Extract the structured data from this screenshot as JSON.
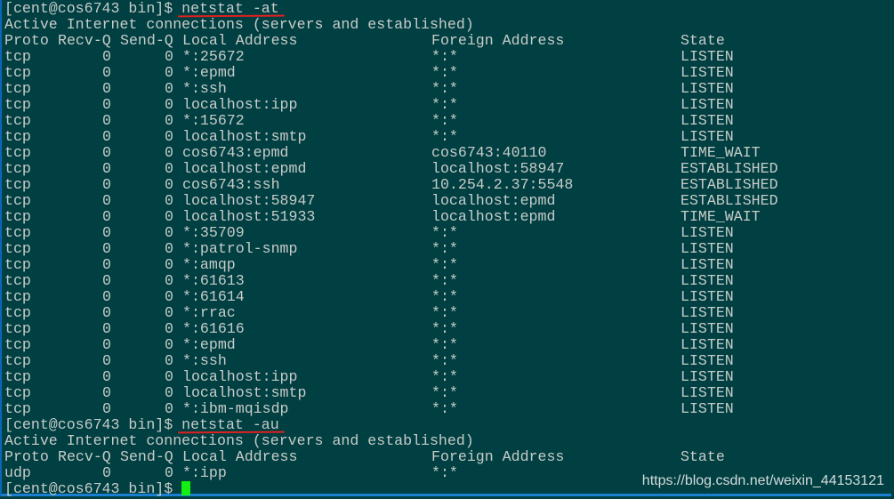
{
  "prompt": "[cent@cos6743 bin]$ ",
  "blocks": [
    {
      "command": "netstat -at",
      "title": "Active Internet connections (servers and established)",
      "headers": {
        "proto": "Proto",
        "recv": "Recv-Q",
        "send": "Send-Q",
        "local": "Local Address",
        "foreign": "Foreign Address",
        "state": "State"
      },
      "rows": [
        {
          "proto": "tcp",
          "recv": "0",
          "send": "0",
          "local": "*:25672",
          "foreign": "*:*",
          "state": "LISTEN"
        },
        {
          "proto": "tcp",
          "recv": "0",
          "send": "0",
          "local": "*:epmd",
          "foreign": "*:*",
          "state": "LISTEN"
        },
        {
          "proto": "tcp",
          "recv": "0",
          "send": "0",
          "local": "*:ssh",
          "foreign": "*:*",
          "state": "LISTEN"
        },
        {
          "proto": "tcp",
          "recv": "0",
          "send": "0",
          "local": "localhost:ipp",
          "foreign": "*:*",
          "state": "LISTEN"
        },
        {
          "proto": "tcp",
          "recv": "0",
          "send": "0",
          "local": "*:15672",
          "foreign": "*:*",
          "state": "LISTEN"
        },
        {
          "proto": "tcp",
          "recv": "0",
          "send": "0",
          "local": "localhost:smtp",
          "foreign": "*:*",
          "state": "LISTEN"
        },
        {
          "proto": "tcp",
          "recv": "0",
          "send": "0",
          "local": "cos6743:epmd",
          "foreign": "cos6743:40110",
          "state": "TIME_WAIT"
        },
        {
          "proto": "tcp",
          "recv": "0",
          "send": "0",
          "local": "localhost:epmd",
          "foreign": "localhost:58947",
          "state": "ESTABLISHED"
        },
        {
          "proto": "tcp",
          "recv": "0",
          "send": "0",
          "local": "cos6743:ssh",
          "foreign": "10.254.2.37:5548",
          "state": "ESTABLISHED"
        },
        {
          "proto": "tcp",
          "recv": "0",
          "send": "0",
          "local": "localhost:58947",
          "foreign": "localhost:epmd",
          "state": "ESTABLISHED"
        },
        {
          "proto": "tcp",
          "recv": "0",
          "send": "0",
          "local": "localhost:51933",
          "foreign": "localhost:epmd",
          "state": "TIME_WAIT"
        },
        {
          "proto": "tcp",
          "recv": "0",
          "send": "0",
          "local": "*:35709",
          "foreign": "*:*",
          "state": "LISTEN"
        },
        {
          "proto": "tcp",
          "recv": "0",
          "send": "0",
          "local": "*:patrol-snmp",
          "foreign": "*:*",
          "state": "LISTEN"
        },
        {
          "proto": "tcp",
          "recv": "0",
          "send": "0",
          "local": "*:amqp",
          "foreign": "*:*",
          "state": "LISTEN"
        },
        {
          "proto": "tcp",
          "recv": "0",
          "send": "0",
          "local": "*:61613",
          "foreign": "*:*",
          "state": "LISTEN"
        },
        {
          "proto": "tcp",
          "recv": "0",
          "send": "0",
          "local": "*:61614",
          "foreign": "*:*",
          "state": "LISTEN"
        },
        {
          "proto": "tcp",
          "recv": "0",
          "send": "0",
          "local": "*:rrac",
          "foreign": "*:*",
          "state": "LISTEN"
        },
        {
          "proto": "tcp",
          "recv": "0",
          "send": "0",
          "local": "*:61616",
          "foreign": "*:*",
          "state": "LISTEN"
        },
        {
          "proto": "tcp",
          "recv": "0",
          "send": "0",
          "local": "*:epmd",
          "foreign": "*:*",
          "state": "LISTEN"
        },
        {
          "proto": "tcp",
          "recv": "0",
          "send": "0",
          "local": "*:ssh",
          "foreign": "*:*",
          "state": "LISTEN"
        },
        {
          "proto": "tcp",
          "recv": "0",
          "send": "0",
          "local": "localhost:ipp",
          "foreign": "*:*",
          "state": "LISTEN"
        },
        {
          "proto": "tcp",
          "recv": "0",
          "send": "0",
          "local": "localhost:smtp",
          "foreign": "*:*",
          "state": "LISTEN"
        },
        {
          "proto": "tcp",
          "recv": "0",
          "send": "0",
          "local": "*:ibm-mqisdp",
          "foreign": "*:*",
          "state": "LISTEN"
        }
      ]
    },
    {
      "command": "netstat -au",
      "title": "Active Internet connections (servers and established)",
      "headers": {
        "proto": "Proto",
        "recv": "Recv-Q",
        "send": "Send-Q",
        "local": "Local Address",
        "foreign": "Foreign Address",
        "state": "State"
      },
      "rows": [
        {
          "proto": "udp",
          "recv": "0",
          "send": "0",
          "local": "*:ipp",
          "foreign": "*:*",
          "state": ""
        }
      ]
    }
  ],
  "watermark": "https://blog.csdn.net/weixin_44153121",
  "colors": {
    "background": "#003f42",
    "text": "#c8ccc8",
    "cursor": "#11f011",
    "annotation": "#e02020"
  }
}
